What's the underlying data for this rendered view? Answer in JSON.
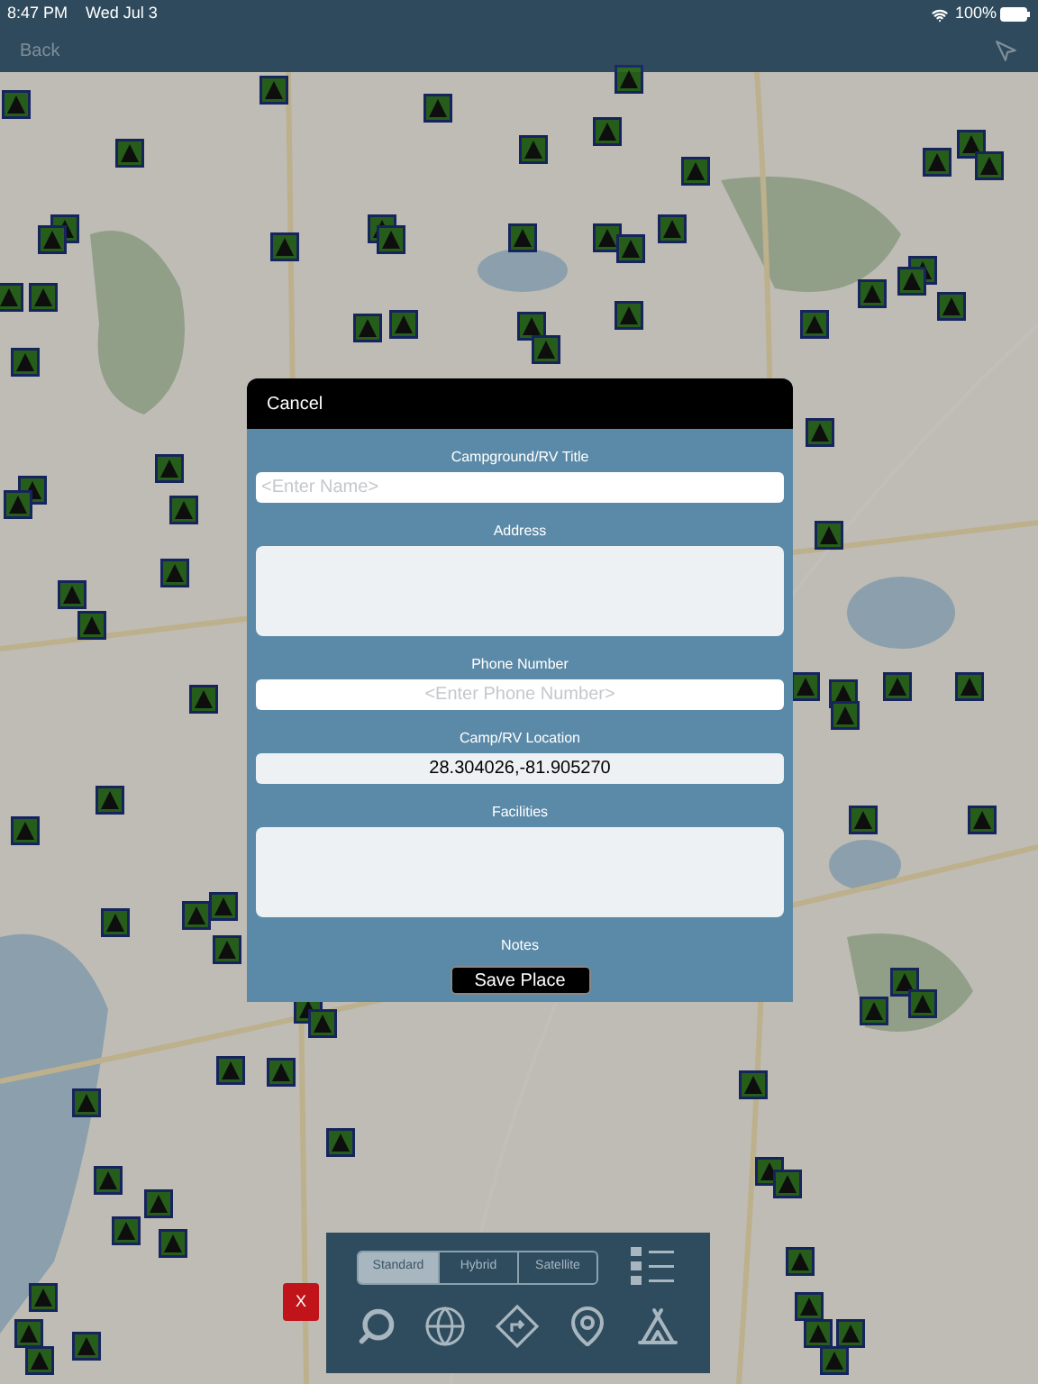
{
  "status_bar": {
    "time": "8:47 PM",
    "date": "Wed Jul 3",
    "battery": "100%"
  },
  "nav": {
    "back": "Back"
  },
  "dialog": {
    "cancel": "Cancel",
    "fields": [
      {
        "kind": "line",
        "label": "Campground/RV Title",
        "placeholder": "<Enter Name>"
      },
      {
        "kind": "area",
        "label": "Address"
      },
      {
        "kind": "centered",
        "label": "Phone Number",
        "placeholder": "<Enter Phone Number>"
      },
      {
        "kind": "centered",
        "label": "Camp/RV Location",
        "value": "28.304026,-81.905270"
      },
      {
        "kind": "area",
        "label": "Facilities"
      },
      {
        "kind": "cut",
        "label": "Notes"
      }
    ],
    "save": "Save Place"
  },
  "close": "X",
  "map_types": [
    {
      "label": "Standard",
      "selected": true
    },
    {
      "label": "Hybrid",
      "selected": false
    },
    {
      "label": "Satellite",
      "selected": false
    }
  ]
}
